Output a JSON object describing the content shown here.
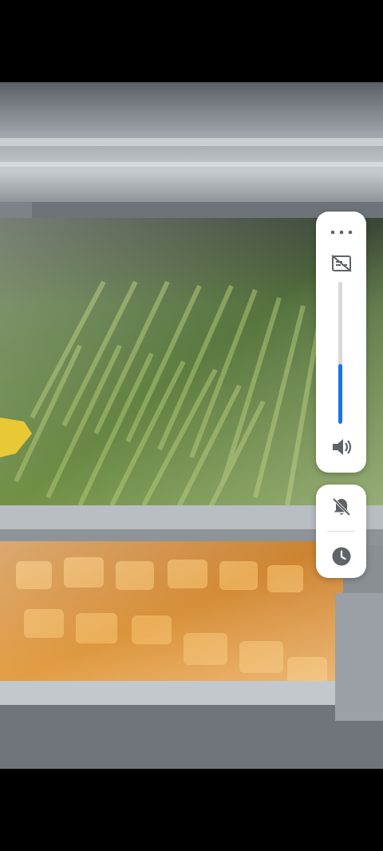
{
  "background": {
    "description_icon": "photo-of-display-fridge"
  },
  "volume_panel": {
    "more_icon": "more-horizontal-icon",
    "captions_icon": "captions-off-icon",
    "volume_level_percent": 42,
    "speaker_icon": "volume-up-icon",
    "accent": "#1a73e8"
  },
  "side_panel": {
    "ringer_icon": "notifications-off-icon",
    "alarm_icon": "clock-icon"
  }
}
